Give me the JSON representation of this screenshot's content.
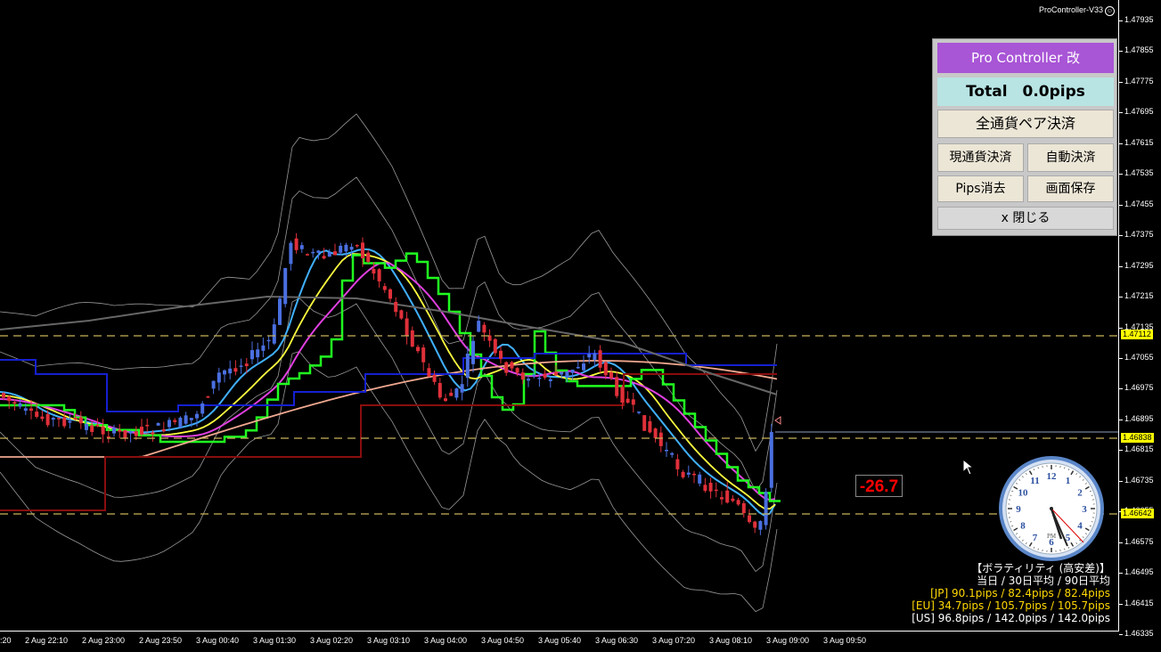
{
  "header": {
    "app_label": "ProController-V33",
    "smile_glyph": "☺"
  },
  "price_axis": [
    "1.47935",
    "1.47855",
    "1.47775",
    "1.47695",
    "1.47615",
    "1.47535",
    "1.47455",
    "1.47375",
    "1.47295",
    "1.47215",
    "1.47135",
    "1.47055",
    "1.46975",
    "1.46895",
    "1.46815",
    "1.46735",
    "1.46655",
    "1.46575",
    "1.46495",
    "1.46415",
    "1.46335"
  ],
  "price_tags": {
    "upper": "1.47112",
    "current": "1.46838",
    "lower": "1.46642"
  },
  "time_axis": [
    ":20",
    "2 Aug 22:10",
    "2 Aug 23:00",
    "2 Aug 23:50",
    "3 Aug 00:40",
    "3 Aug 01:30",
    "3 Aug 02:20",
    "3 Aug 03:10",
    "3 Aug 04:00",
    "3 Aug 04:50",
    "3 Aug 05:40",
    "3 Aug 06:30",
    "3 Aug 07:20",
    "3 Aug 08:10",
    "3 Aug 09:00",
    "3 Aug 09:50"
  ],
  "panel": {
    "title": "Pro Controller 改",
    "total": "Total　0.0pips",
    "close_all_pairs": "全通貨ペア決済",
    "close_current": "現通貨決済",
    "auto_close": "自動決済",
    "clear_pips": "Pips消去",
    "save_screen": "画面保存",
    "close_panel": "x 閉じる"
  },
  "pips_badge": "-26.7",
  "clock": {
    "numbers": [
      "12",
      "1",
      "2",
      "3",
      "4",
      "5",
      "6",
      "7",
      "8",
      "9",
      "10",
      "11"
    ],
    "ampm": "PM"
  },
  "volatility": {
    "title": "【ボラティリティ (高安差)】",
    "header": "当日 / 30日平均 / 90日平均",
    "jp": "[JP] 90.1pips / 82.4pips / 82.4pips",
    "eu": "[EU] 34.7pips / 105.7pips / 105.7pips",
    "us": "[US] 96.8pips / 142.0pips / 142.0pips"
  },
  "colors": {
    "background": "#000000",
    "bullish": "#4a6fe0",
    "bearish": "#e0303a",
    "ma_yellow": "#ffff40",
    "ma_magenta": "#e040e0",
    "ma_skyblue": "#40b0ff",
    "ma_green": "#20ff20",
    "ma_salmon": "#f0a890",
    "level_line": "#c8b45a",
    "panel_title": "#a855d6",
    "panel_total": "#b8e4e4"
  }
}
